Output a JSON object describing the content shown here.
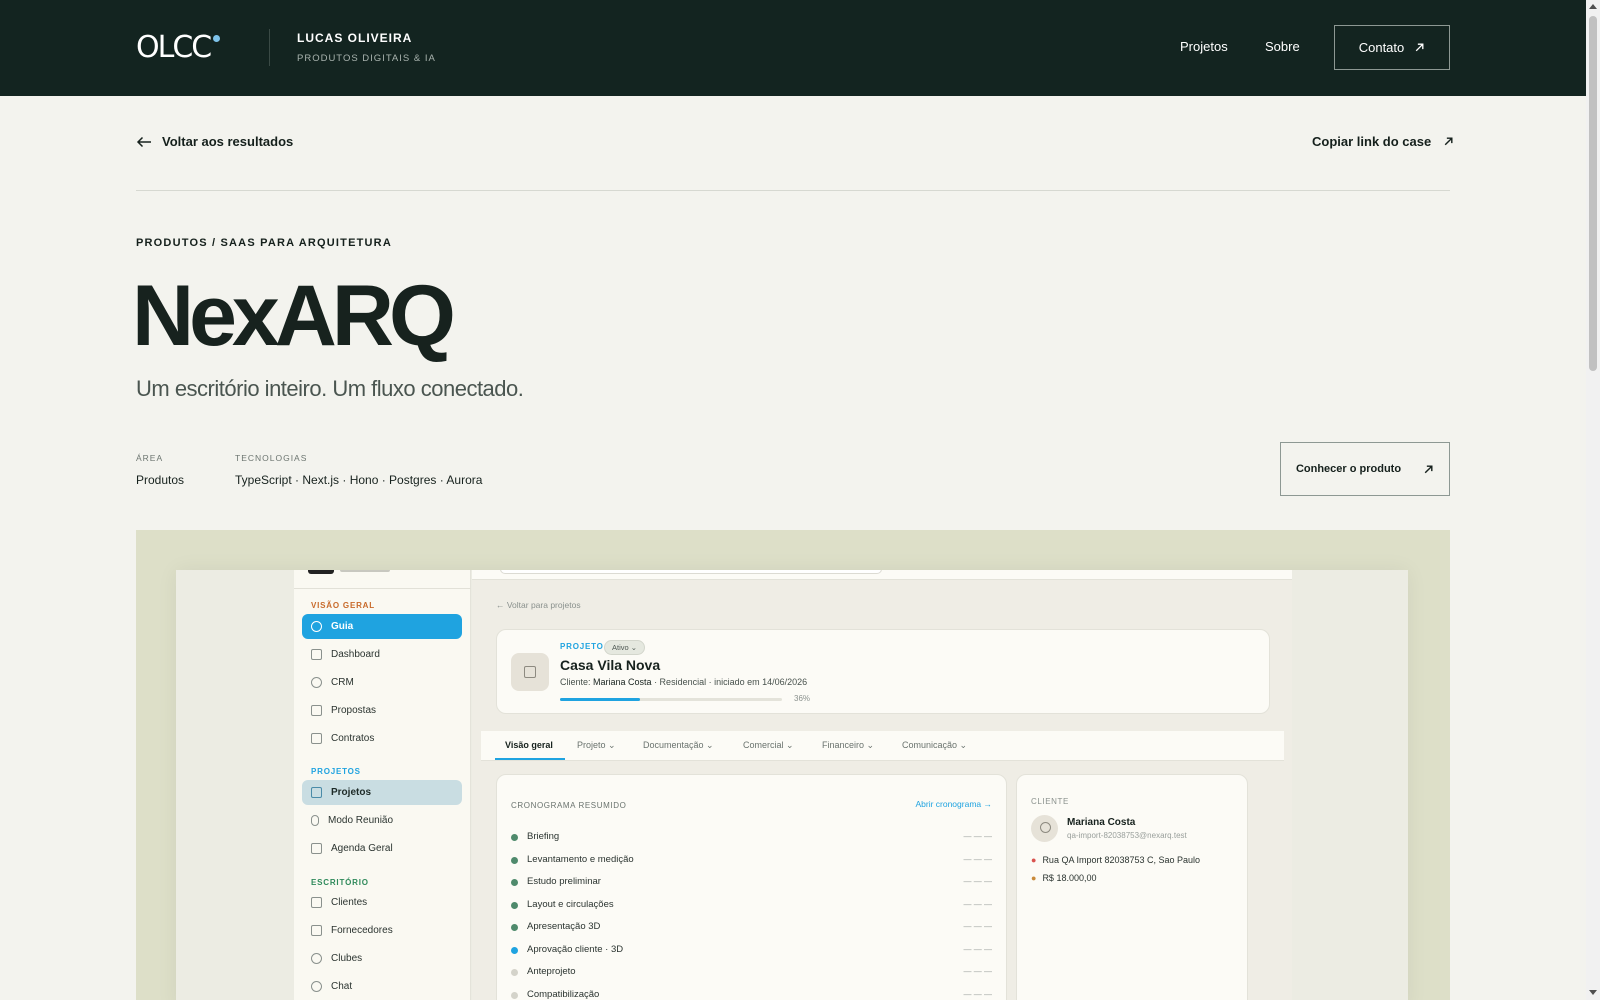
{
  "header": {
    "logo": "OLCC",
    "name": "LUCAS OLIVEIRA",
    "tagline": "PRODUTOS DIGITAIS & IA",
    "nav": [
      "Projetos",
      "Sobre"
    ],
    "contact_label": "Contato"
  },
  "page": {
    "back_label": "Voltar aos resultados",
    "copy_link_label": "Copiar link do case",
    "eyebrow": "PRODUTOS / SAAS PARA ARQUITETURA",
    "title": "NexARQ",
    "subtitle": "Um escritório inteiro. Um fluxo conectado.",
    "meta": [
      {
        "label": "ÁREA",
        "value": "Produtos"
      },
      {
        "label": "TECNOLOGIAS",
        "value": "TypeScript · Next.js · Hono · Postgres · Aurora"
      }
    ],
    "product_button": "Conhecer o produto"
  },
  "mockup": {
    "sidebar": {
      "sections": [
        {
          "title": "VISÃO GERAL",
          "color": "#c86a2a",
          "items": [
            "Guia",
            "Dashboard",
            "CRM",
            "Propostas",
            "Contratos"
          ]
        },
        {
          "title": "PROJETOS",
          "color": "#1fa3e0",
          "items": [
            "Projetos",
            "Modo Reunião",
            "Agenda Geral"
          ]
        },
        {
          "title": "ESCRITÓRIO",
          "color": "#2f8a5b",
          "items": [
            "Clientes",
            "Fornecedores",
            "Clubes",
            "Chat"
          ]
        }
      ]
    },
    "back_label": "← Voltar para projetos",
    "project": {
      "label": "PROJETO",
      "status": "Ativo ⌄",
      "name": "Casa Vila Nova",
      "client_prefix": "Cliente: ",
      "client_name": "Mariana Costa",
      "details": " · Residencial · iniciado em 14/06/2026",
      "progress": 0.36,
      "progress_label": "36%"
    },
    "tabs": [
      "Visão geral",
      "Projeto ⌄",
      "Documentação ⌄",
      "Comercial ⌄",
      "Financeiro ⌄",
      "Comunicação ⌄"
    ],
    "schedule": {
      "title": "CRONOGRAMA RESUMIDO",
      "link": "Abrir cronograma →",
      "rows": [
        {
          "label": "Briefing",
          "status": "done",
          "value": "— — —"
        },
        {
          "label": "Levantamento e medição",
          "status": "done",
          "value": "— — —"
        },
        {
          "label": "Estudo preliminar",
          "status": "done",
          "value": "— — —"
        },
        {
          "label": "Layout e circulações",
          "status": "done",
          "value": "— — —"
        },
        {
          "label": "Apresentação 3D",
          "status": "done",
          "value": "— — —"
        },
        {
          "label": "Aprovação cliente · 3D",
          "status": "current",
          "value": "— — —"
        },
        {
          "label": "Anteprojeto",
          "status": "pending",
          "value": "— — —"
        },
        {
          "label": "Compatibilização",
          "status": "pending",
          "value": "— — —"
        }
      ],
      "colors": {
        "done": "#4f8a6c",
        "current": "#1fa3e0",
        "pending": "#d4d3ca"
      }
    },
    "client": {
      "title": "CLIENTE",
      "name": "Mariana Costa",
      "email": "qa-import-82038753@nexarq.test",
      "address": "Rua QA Import 82038753 C, Sao Paulo",
      "budget": "R$ 18.000,00"
    }
  }
}
